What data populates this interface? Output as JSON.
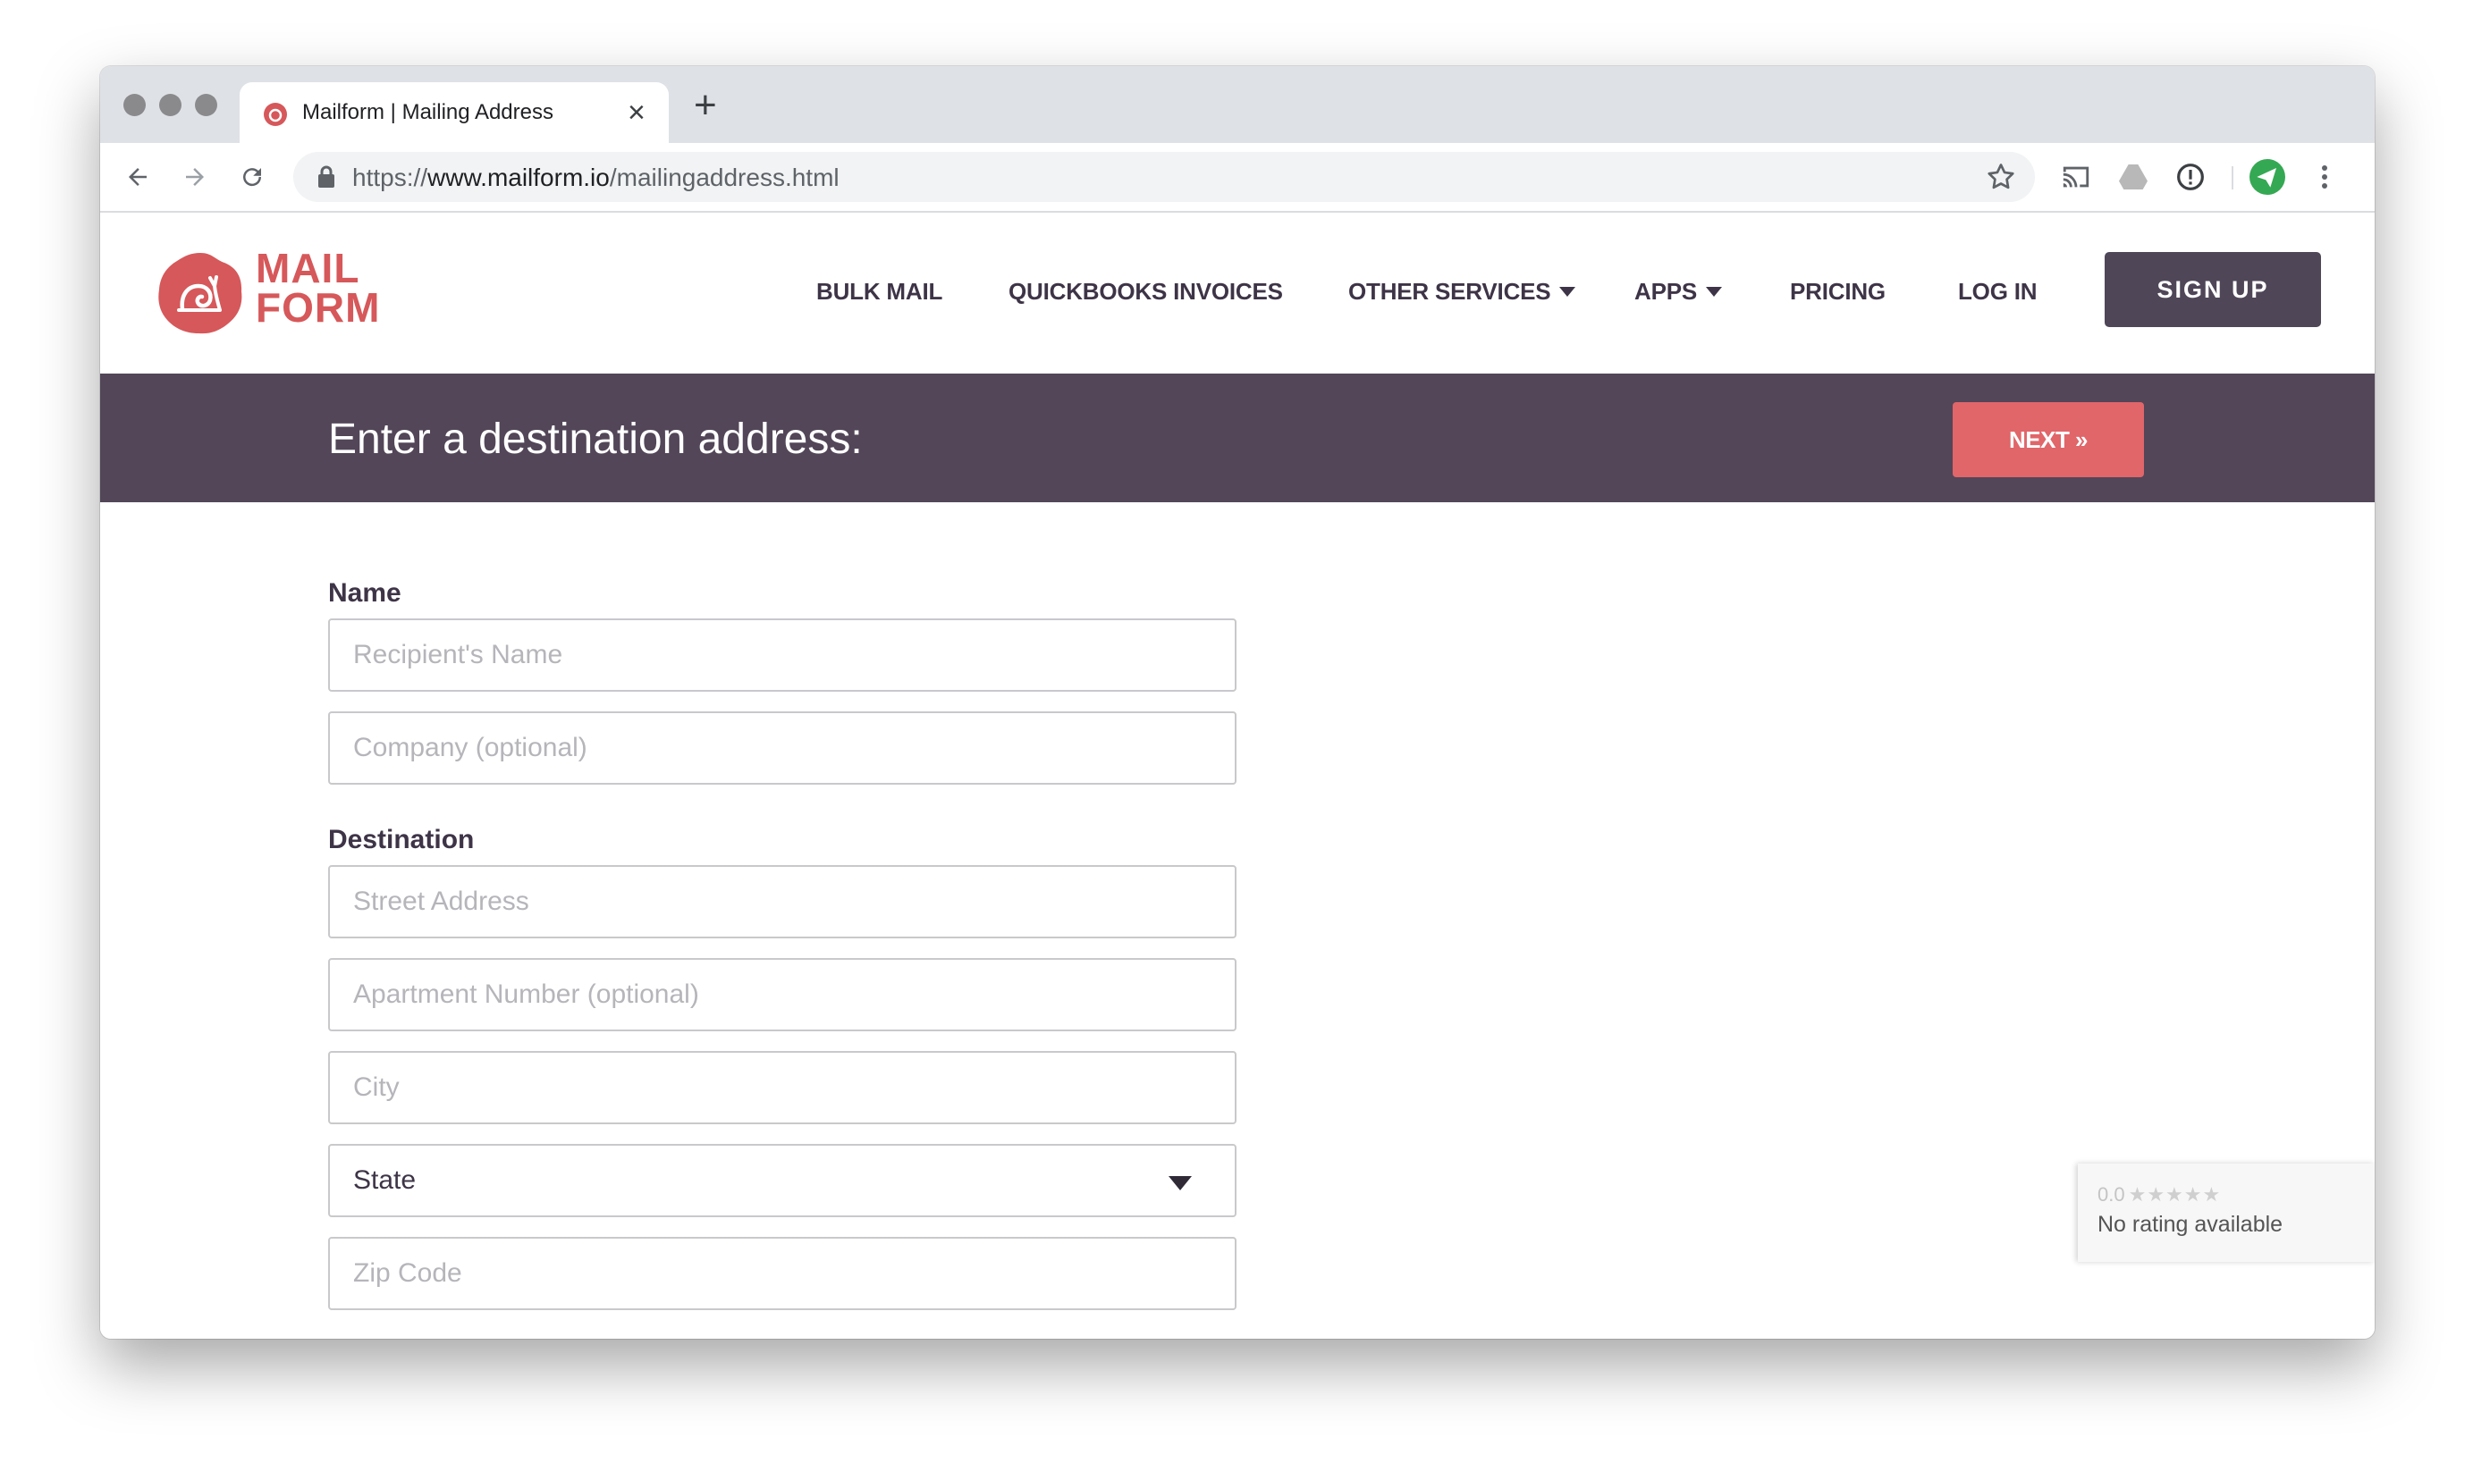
{
  "browser": {
    "tab_title": "Mailform | Mailing Address",
    "new_tab": "+",
    "close_tab": "×",
    "url_scheme": "https://",
    "url_host": "www.mailform.io",
    "url_path": "/mailingaddress.html"
  },
  "header": {
    "logo_line1": "MAIL",
    "logo_line2": "FORM",
    "nav": {
      "bulk_mail": "BULK MAIL",
      "quickbooks": "QUICKBOOKS INVOICES",
      "other_services": "OTHER SERVICES",
      "apps": "APPS",
      "pricing": "PRICING",
      "login": "LOG IN"
    },
    "signup": "SIGN UP"
  },
  "banner": {
    "title": "Enter a destination address:",
    "next": "NEXT »"
  },
  "form": {
    "name_label": "Name",
    "recipient_placeholder": "Recipient's Name",
    "company_placeholder": "Company (optional)",
    "destination_label": "Destination",
    "street_placeholder": "Street Address",
    "apartment_placeholder": "Apartment Number (optional)",
    "city_placeholder": "City",
    "state_selected": "State",
    "zip_placeholder": "Zip Code"
  },
  "rating": {
    "score": "0.0",
    "stars": "★★★★★",
    "text": "No rating available"
  },
  "colors": {
    "brand": "#d6585a",
    "dark": "#524658",
    "next_button": "#e0666a"
  }
}
